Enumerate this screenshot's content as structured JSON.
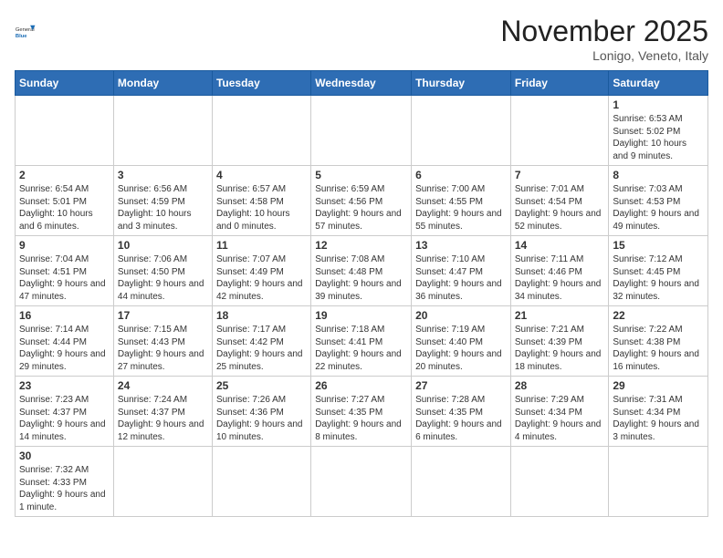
{
  "header": {
    "logo_general": "General",
    "logo_blue": "Blue",
    "month_title": "November 2025",
    "location": "Lonigo, Veneto, Italy"
  },
  "weekdays": [
    "Sunday",
    "Monday",
    "Tuesday",
    "Wednesday",
    "Thursday",
    "Friday",
    "Saturday"
  ],
  "weeks": [
    [
      {
        "day": "",
        "info": ""
      },
      {
        "day": "",
        "info": ""
      },
      {
        "day": "",
        "info": ""
      },
      {
        "day": "",
        "info": ""
      },
      {
        "day": "",
        "info": ""
      },
      {
        "day": "",
        "info": ""
      },
      {
        "day": "1",
        "info": "Sunrise: 6:53 AM\nSunset: 5:02 PM\nDaylight: 10 hours and 9 minutes."
      }
    ],
    [
      {
        "day": "2",
        "info": "Sunrise: 6:54 AM\nSunset: 5:01 PM\nDaylight: 10 hours and 6 minutes."
      },
      {
        "day": "3",
        "info": "Sunrise: 6:56 AM\nSunset: 4:59 PM\nDaylight: 10 hours and 3 minutes."
      },
      {
        "day": "4",
        "info": "Sunrise: 6:57 AM\nSunset: 4:58 PM\nDaylight: 10 hours and 0 minutes."
      },
      {
        "day": "5",
        "info": "Sunrise: 6:59 AM\nSunset: 4:56 PM\nDaylight: 9 hours and 57 minutes."
      },
      {
        "day": "6",
        "info": "Sunrise: 7:00 AM\nSunset: 4:55 PM\nDaylight: 9 hours and 55 minutes."
      },
      {
        "day": "7",
        "info": "Sunrise: 7:01 AM\nSunset: 4:54 PM\nDaylight: 9 hours and 52 minutes."
      },
      {
        "day": "8",
        "info": "Sunrise: 7:03 AM\nSunset: 4:53 PM\nDaylight: 9 hours and 49 minutes."
      }
    ],
    [
      {
        "day": "9",
        "info": "Sunrise: 7:04 AM\nSunset: 4:51 PM\nDaylight: 9 hours and 47 minutes."
      },
      {
        "day": "10",
        "info": "Sunrise: 7:06 AM\nSunset: 4:50 PM\nDaylight: 9 hours and 44 minutes."
      },
      {
        "day": "11",
        "info": "Sunrise: 7:07 AM\nSunset: 4:49 PM\nDaylight: 9 hours and 42 minutes."
      },
      {
        "day": "12",
        "info": "Sunrise: 7:08 AM\nSunset: 4:48 PM\nDaylight: 9 hours and 39 minutes."
      },
      {
        "day": "13",
        "info": "Sunrise: 7:10 AM\nSunset: 4:47 PM\nDaylight: 9 hours and 36 minutes."
      },
      {
        "day": "14",
        "info": "Sunrise: 7:11 AM\nSunset: 4:46 PM\nDaylight: 9 hours and 34 minutes."
      },
      {
        "day": "15",
        "info": "Sunrise: 7:12 AM\nSunset: 4:45 PM\nDaylight: 9 hours and 32 minutes."
      }
    ],
    [
      {
        "day": "16",
        "info": "Sunrise: 7:14 AM\nSunset: 4:44 PM\nDaylight: 9 hours and 29 minutes."
      },
      {
        "day": "17",
        "info": "Sunrise: 7:15 AM\nSunset: 4:43 PM\nDaylight: 9 hours and 27 minutes."
      },
      {
        "day": "18",
        "info": "Sunrise: 7:17 AM\nSunset: 4:42 PM\nDaylight: 9 hours and 25 minutes."
      },
      {
        "day": "19",
        "info": "Sunrise: 7:18 AM\nSunset: 4:41 PM\nDaylight: 9 hours and 22 minutes."
      },
      {
        "day": "20",
        "info": "Sunrise: 7:19 AM\nSunset: 4:40 PM\nDaylight: 9 hours and 20 minutes."
      },
      {
        "day": "21",
        "info": "Sunrise: 7:21 AM\nSunset: 4:39 PM\nDaylight: 9 hours and 18 minutes."
      },
      {
        "day": "22",
        "info": "Sunrise: 7:22 AM\nSunset: 4:38 PM\nDaylight: 9 hours and 16 minutes."
      }
    ],
    [
      {
        "day": "23",
        "info": "Sunrise: 7:23 AM\nSunset: 4:37 PM\nDaylight: 9 hours and 14 minutes."
      },
      {
        "day": "24",
        "info": "Sunrise: 7:24 AM\nSunset: 4:37 PM\nDaylight: 9 hours and 12 minutes."
      },
      {
        "day": "25",
        "info": "Sunrise: 7:26 AM\nSunset: 4:36 PM\nDaylight: 9 hours and 10 minutes."
      },
      {
        "day": "26",
        "info": "Sunrise: 7:27 AM\nSunset: 4:35 PM\nDaylight: 9 hours and 8 minutes."
      },
      {
        "day": "27",
        "info": "Sunrise: 7:28 AM\nSunset: 4:35 PM\nDaylight: 9 hours and 6 minutes."
      },
      {
        "day": "28",
        "info": "Sunrise: 7:29 AM\nSunset: 4:34 PM\nDaylight: 9 hours and 4 minutes."
      },
      {
        "day": "29",
        "info": "Sunrise: 7:31 AM\nSunset: 4:34 PM\nDaylight: 9 hours and 3 minutes."
      }
    ],
    [
      {
        "day": "30",
        "info": "Sunrise: 7:32 AM\nSunset: 4:33 PM\nDaylight: 9 hours and 1 minute."
      },
      {
        "day": "",
        "info": ""
      },
      {
        "day": "",
        "info": ""
      },
      {
        "day": "",
        "info": ""
      },
      {
        "day": "",
        "info": ""
      },
      {
        "day": "",
        "info": ""
      },
      {
        "day": "",
        "info": ""
      }
    ]
  ]
}
